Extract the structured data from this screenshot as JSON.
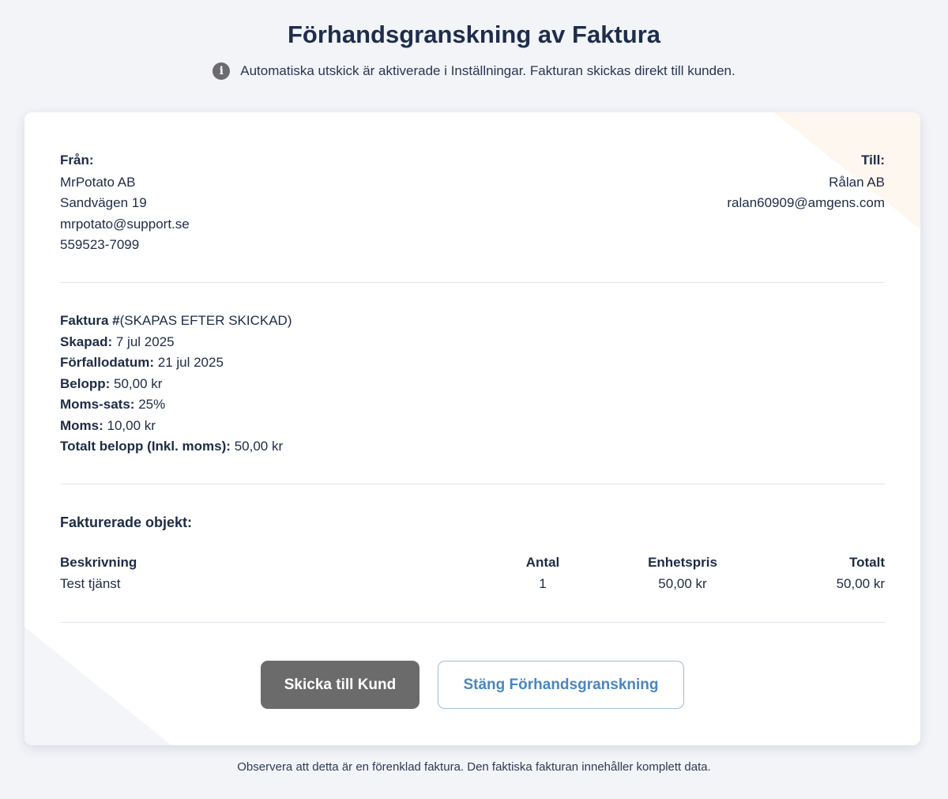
{
  "header": {
    "title": "Förhandsgranskning av Faktura",
    "notice": "Automatiska utskick är aktiverade i Inställningar. Fakturan skickas direkt till kunden.",
    "notice_icon": "info-icon"
  },
  "from": {
    "heading": "Från:",
    "lines": [
      "MrPotato AB",
      "Sandvägen 19",
      "mrpotato@support.se",
      "559523-7099"
    ]
  },
  "to": {
    "heading": "Till:",
    "lines": [
      "Rålan AB",
      "ralan60909@amgens.com"
    ]
  },
  "invoice": {
    "number_label": "Faktura #",
    "number_value": "(SKAPAS EFTER SKICKAD)",
    "created_label": "Skapad:",
    "created_value": "7 jul 2025",
    "due_label": "Förfallodatum:",
    "due_value": "21 jul 2025",
    "amount_label": "Belopp:",
    "amount_value": "50,00 kr",
    "vat_rate_label": "Moms-sats:",
    "vat_rate_value": "25%",
    "vat_label": "Moms:",
    "vat_value": "10,00 kr",
    "total_label": "Totalt belopp (Inkl. moms):",
    "total_value": "50,00 kr"
  },
  "items": {
    "title": "Fakturerade objekt:",
    "columns": [
      "Beskrivning",
      "Antal",
      "Enhetspris",
      "Totalt"
    ],
    "rows": [
      [
        "Test tjänst",
        "1",
        "50,00 kr",
        "50,00 kr"
      ]
    ]
  },
  "actions": {
    "send_label": "Skicka till Kund",
    "close_label": "Stäng Förhandsgranskning"
  },
  "footer": {
    "note": "Observera att detta är en förenklad faktura. Den faktiska fakturan innehåller komplett data."
  },
  "colors": {
    "background": "#f2f4f8",
    "text": "#1e2b45",
    "send_button": "#6b6b6b",
    "close_button_text": "#4a86c0"
  }
}
